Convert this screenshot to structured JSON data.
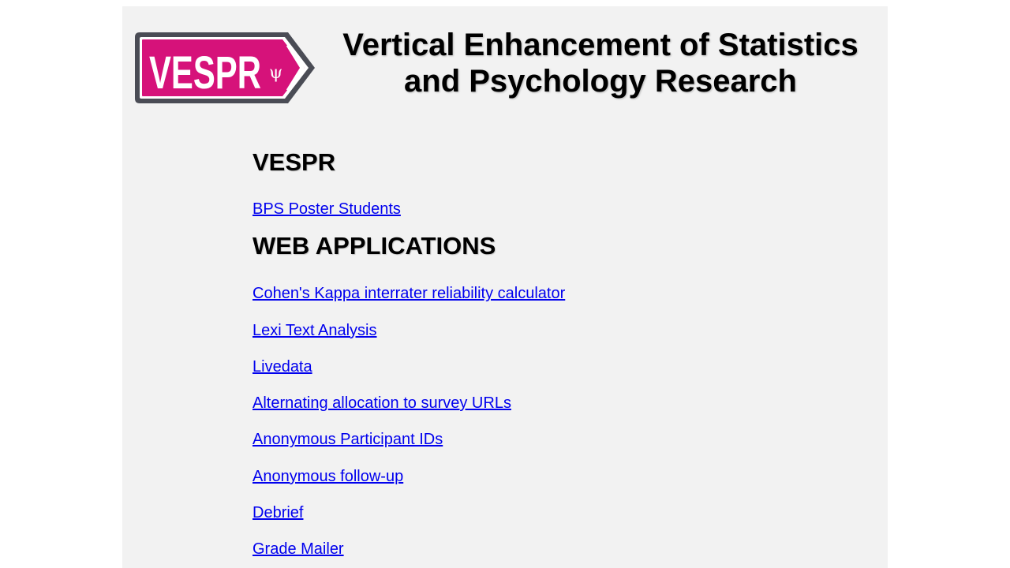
{
  "header": {
    "logo": {
      "text": "VESPR",
      "symbol": "ψ",
      "colors": {
        "fill": "#d6127a",
        "border": "#4a4c55",
        "text": "#ffffff"
      }
    },
    "title": "Vertical Enhancement of Statistics and Psychology Research"
  },
  "sections": [
    {
      "heading": "VESPR",
      "links": [
        {
          "label": "BPS Poster Students"
        }
      ]
    },
    {
      "heading": "WEB APPLICATIONS",
      "links": [
        {
          "label": "Cohen's Kappa interrater reliability calculator"
        },
        {
          "label": "Lexi Text Analysis"
        },
        {
          "label": "Livedata"
        },
        {
          "label": "Alternating allocation to survey URLs"
        },
        {
          "label": "Anonymous Participant IDs"
        },
        {
          "label": "Anonymous follow-up"
        },
        {
          "label": "Debrief"
        },
        {
          "label": "Grade Mailer"
        }
      ]
    }
  ],
  "colors": {
    "link": "#0000ee",
    "page_background": "#f2f2f2"
  }
}
